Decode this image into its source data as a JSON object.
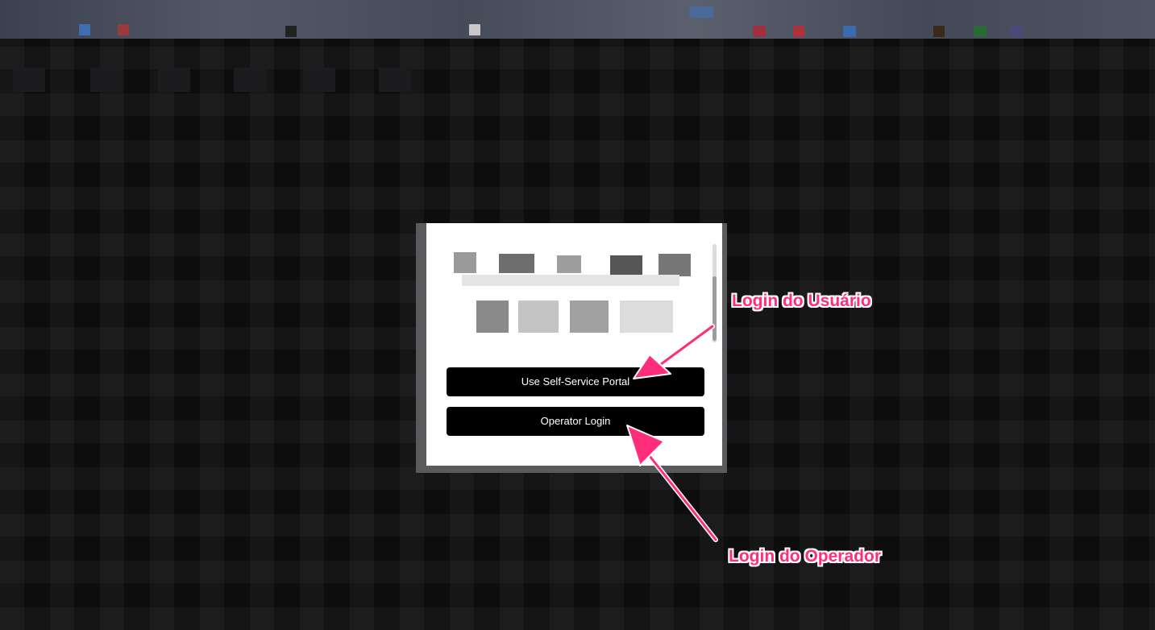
{
  "modal": {
    "buttons": {
      "self_service": "Use Self-Service Portal",
      "operator_login": "Operator Login"
    }
  },
  "annotations": {
    "user_login": "Login do Usuário",
    "operator_login": "Login do Operador"
  },
  "colors": {
    "annotation_text": "#ff2d7a",
    "annotation_outline": "#ffffff",
    "button_background": "#000000",
    "button_text": "#ffffff",
    "modal_background": "#ffffff",
    "page_background": "#0d0d0e"
  }
}
